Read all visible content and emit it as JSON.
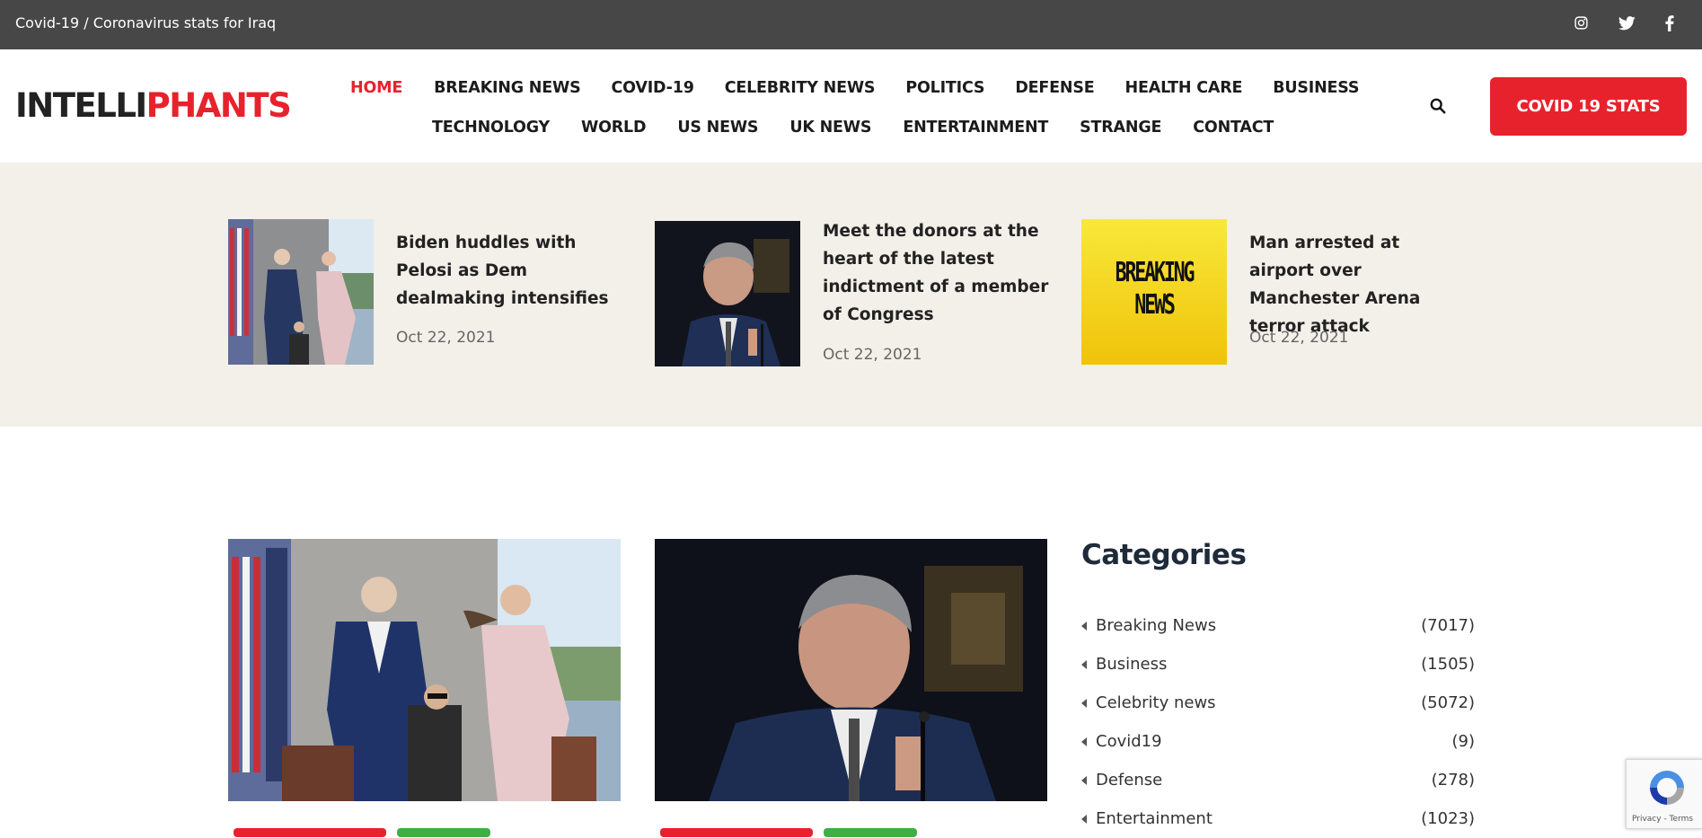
{
  "topbar": {
    "covid_link": "Covid-19 / Coronavirus stats for Iraq",
    "social_icons": [
      "instagram-icon",
      "twitter-icon",
      "facebook-icon"
    ]
  },
  "header": {
    "logo_part1": "INTELLI",
    "logo_part2": "PHANTS",
    "nav_row1": [
      "HOME",
      "BREAKING NEWS",
      "COVID-19",
      "CELEBRITY NEWS",
      "POLITICS",
      "DEFENSE",
      "HEALTH CARE",
      "BUSINESS"
    ],
    "nav_row2": [
      "TECHNOLOGY",
      "WORLD",
      "US NEWS",
      "UK NEWS",
      "ENTERTAINMENT",
      "STRANGE",
      "CONTACT"
    ],
    "active_nav": "HOME",
    "search_icon": "search-icon",
    "covid_button": "COVID 19 STATS"
  },
  "featured": [
    {
      "title": "Biden huddles with Pelosi as Dem dealmaking intensifies",
      "date": "Oct 22, 2021"
    },
    {
      "title": "Meet the donors at the heart of the latest indictment of a member of Congress",
      "date": "Oct 22, 2021"
    },
    {
      "title": "Man arrested at airport over Manchester Arena terror attack",
      "date": "Oct 22, 2021"
    }
  ],
  "breaking_news_image_text": [
    "BREAKING",
    "NEWS"
  ],
  "sidebar": {
    "title": "Categories",
    "categories": [
      {
        "name": "Breaking News",
        "count": "(7017)"
      },
      {
        "name": "Business",
        "count": "(1505)"
      },
      {
        "name": "Celebrity news",
        "count": "(5072)"
      },
      {
        "name": "Covid19",
        "count": "(9)"
      },
      {
        "name": "Defense",
        "count": "(278)"
      },
      {
        "name": "Entertainment",
        "count": "(1023)"
      }
    ]
  },
  "recaptcha": {
    "footer": "Privacy - Terms"
  },
  "colors": {
    "accent": "#e8222d",
    "topbar": "#474747",
    "band": "#f3efe9",
    "tag_green": "#3fae49"
  }
}
